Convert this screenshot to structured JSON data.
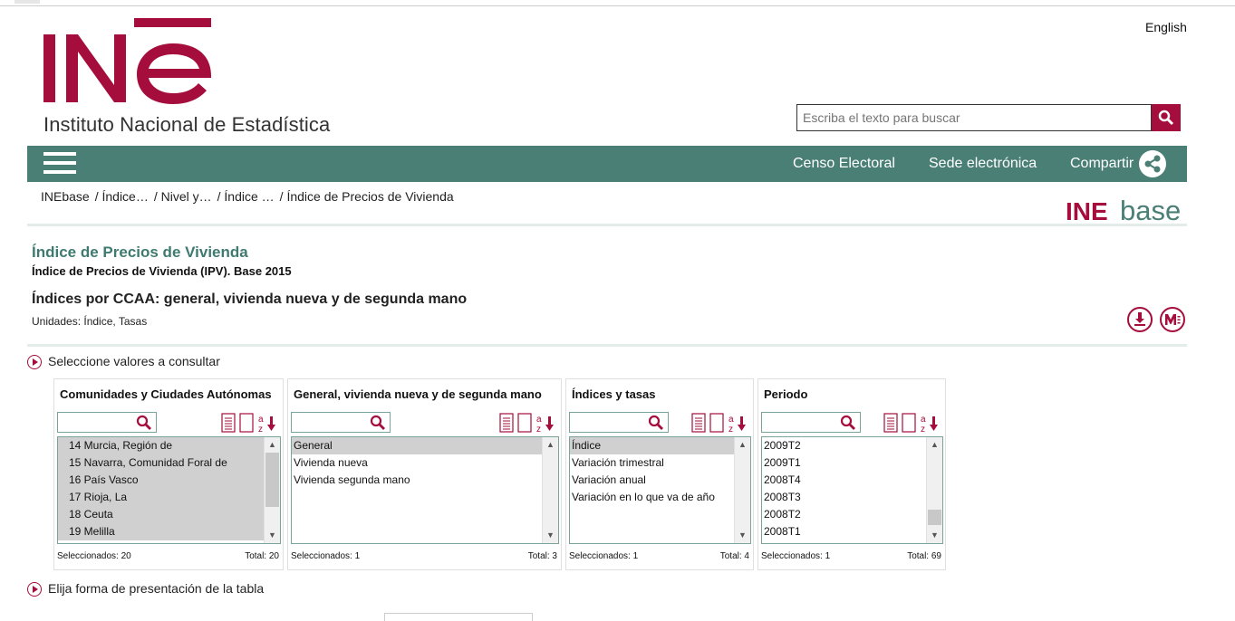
{
  "header": {
    "language_link": "English",
    "logo_text": "INE",
    "org_name": "Instituto Nacional de Estadística",
    "search_placeholder": "Escriba el texto para buscar",
    "brand_color": "#a50d3c",
    "nav_color": "#4a7f76"
  },
  "nav": {
    "links": [
      "Censo Electoral",
      "Sede electrónica",
      "Compartir"
    ]
  },
  "breadcrumb": [
    "INEbase",
    "/ Índice…",
    "/ Nivel y…",
    "/ Índice …",
    "/ Índice de Precios de Vivienda"
  ],
  "inebase_logo": {
    "ine": "INE",
    "base": "base"
  },
  "table": {
    "section_title": "Índice de Precios de Vivienda",
    "operation": "Índice de Precios de Vivienda (IPV). Base 2015",
    "table_title": "Índices por CCAA: general, vivienda nueva y de segunda mano",
    "units": "Unidades: Índice, Tasas"
  },
  "sections": {
    "select_values": "Seleccione valores a consultar",
    "presentation": "Elija forma de presentación de la tabla"
  },
  "panels": [
    {
      "header": "Comunidades y Ciudades Autónomas",
      "items": [
        "14 Murcia, Región de",
        "15 Navarra, Comunidad Foral de",
        "16 País Vasco",
        "17 Rioja, La",
        "18 Ceuta",
        "19 Melilla"
      ],
      "selected": [
        true,
        true,
        true,
        true,
        true,
        true
      ],
      "selected_label": "Seleccionados: 20",
      "total_label": "Total: 20"
    },
    {
      "header": "General, vivienda nueva y de segunda mano",
      "items": [
        "General",
        "Vivienda nueva",
        "Vivienda segunda mano"
      ],
      "selected": [
        true,
        false,
        false
      ],
      "selected_label": "Seleccionados: 1",
      "total_label": "Total: 3"
    },
    {
      "header": "Índices y tasas",
      "items": [
        "Índice",
        "Variación trimestral",
        "Variación anual",
        "Variación en lo que va de año"
      ],
      "selected": [
        true,
        false,
        false,
        false
      ],
      "selected_label": "Seleccionados: 1",
      "total_label": "Total: 4"
    },
    {
      "header": "Periodo",
      "items": [
        "2009T2",
        "2009T1",
        "2008T4",
        "2008T3",
        "2008T2",
        "2008T1"
      ],
      "selected": [
        false,
        false,
        false,
        false,
        false,
        false
      ],
      "selected_label": "Seleccionados: 1",
      "total_label": "Total: 69"
    }
  ]
}
